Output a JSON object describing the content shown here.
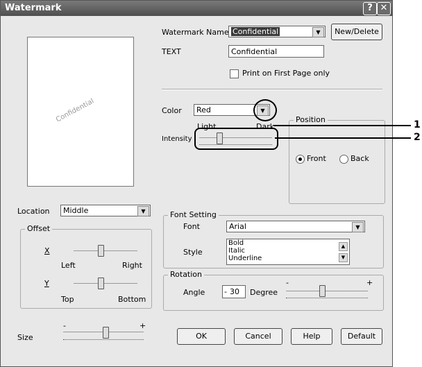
{
  "window": {
    "title": "Watermark",
    "help_glyph": "?",
    "close_glyph": "✕"
  },
  "preview": {
    "watermark_text": "Confidential"
  },
  "watermark_name": {
    "label": "Watermark Name",
    "value": "Confidential"
  },
  "new_delete_label": "New/Delete",
  "text_field": {
    "label": "TEXT",
    "value": "Confidential"
  },
  "print_first_page": {
    "label": "Print on First Page only",
    "checked": false
  },
  "color": {
    "label": "Color",
    "value": "Red"
  },
  "intensity": {
    "label": "Intensity",
    "light_label": "Light",
    "dark_label": "Dark",
    "level": 0.25
  },
  "position": {
    "title": "Position",
    "front_label": "Front",
    "back_label": "Back",
    "selected": "Front"
  },
  "font_setting": {
    "title": "Font Setting",
    "font_label": "Font",
    "font_value": "Arial",
    "style_label": "Style",
    "styles": [
      "Bold",
      "Italic",
      "Underline"
    ]
  },
  "location": {
    "label": "Location",
    "value": "Middle"
  },
  "offset": {
    "title": "Offset",
    "x_label": "X",
    "y_label": "Y",
    "left_label": "Left",
    "right_label": "Right",
    "top_label": "Top",
    "bottom_label": "Bottom"
  },
  "rotation": {
    "title": "Rotation",
    "angle_label": "Angle",
    "minus_glyph": "-",
    "angle_value": "30",
    "unit_label": "Degree",
    "slider_minus": "-",
    "slider_plus": "+"
  },
  "size": {
    "label": "Size",
    "slider_minus": "-",
    "slider_plus": "+"
  },
  "buttons": {
    "ok": "OK",
    "cancel": "Cancel",
    "help": "Help",
    "default": "Default"
  },
  "callouts": {
    "one": "1",
    "two": "2"
  }
}
